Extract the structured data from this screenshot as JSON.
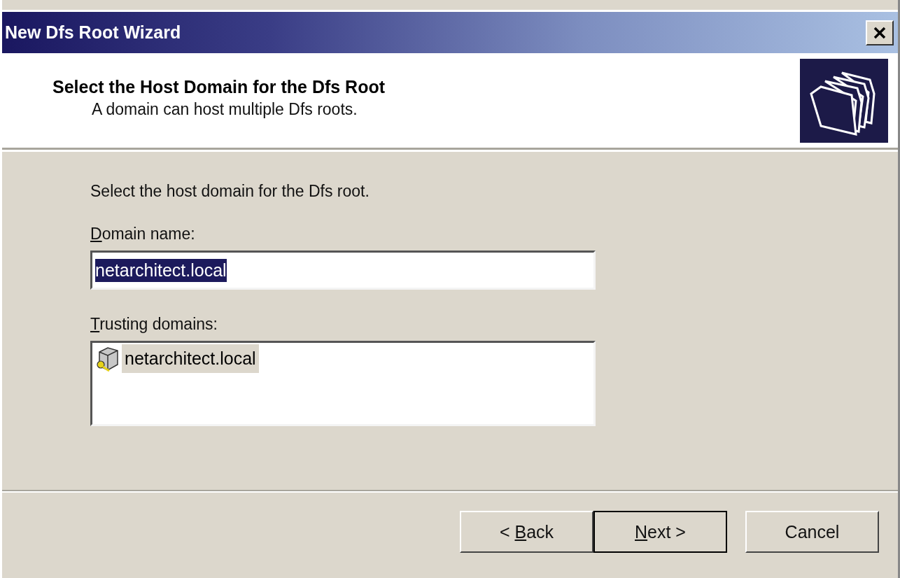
{
  "window": {
    "title": "New Dfs Root Wizard"
  },
  "header": {
    "title": "Select the Host Domain for the Dfs Root",
    "subtitle": "A domain can host multiple Dfs roots."
  },
  "instruction": "Select the host domain for the Dfs root.",
  "domain_field": {
    "access_key": "D",
    "label_rest": "omain name:",
    "value": "netarchitect.local",
    "value_selected": true
  },
  "trusting_domains": {
    "access_key": "T",
    "label_rest": "rusting domains:",
    "items": [
      {
        "name": "netarchitect.local",
        "selected": true
      }
    ]
  },
  "buttons": [
    {
      "before": "< ",
      "access_key": "B",
      "rest": "ack",
      "default": false
    },
    {
      "access_key": "N",
      "rest": "ext >",
      "default": true
    },
    {
      "rest": "Cancel",
      "default": false
    }
  ]
}
